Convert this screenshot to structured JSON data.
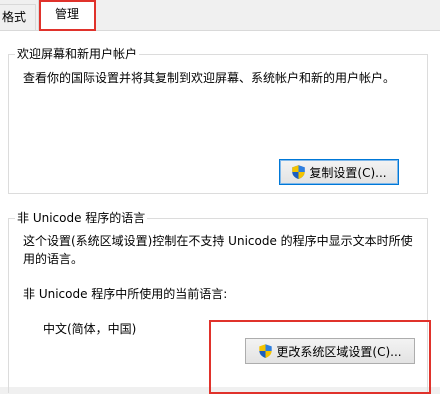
{
  "tabs": [
    {
      "label": "格式",
      "active": false
    },
    {
      "label": "管理",
      "active": true
    }
  ],
  "welcome_group": {
    "title": "欢迎屏幕和新用户帐户",
    "description": "查看你的国际设置并将其复制到欢迎屏幕、系统帐户和新的用户帐户。",
    "button_label": "复制设置(C)..."
  },
  "unicode_group": {
    "title": "非 Unicode 程序的语言",
    "description_line1": "这个设置(系统区域设置)控制在不支持 Unicode 的程序中显示文本时所使",
    "description_line2": "用的语言。",
    "current_label": "非 Unicode 程序中所使用的当前语言:",
    "current_value": "中文(简体，中国)",
    "button_label": "更改系统区域设置(C)..."
  },
  "colors": {
    "highlight": "#e0322b",
    "focus_border": "#0078d7"
  },
  "icons": {
    "button_icon": "uac-shield-icon"
  }
}
